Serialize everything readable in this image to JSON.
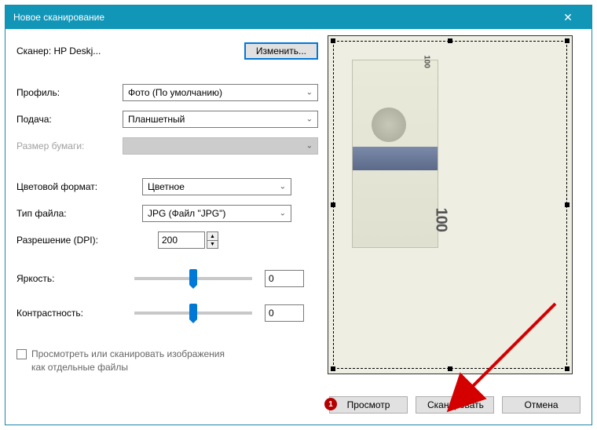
{
  "window": {
    "title": "Новое сканирование",
    "close": "✕"
  },
  "scanner": {
    "label": "Сканер: HP Deskj...",
    "change_button": "Изменить..."
  },
  "profile": {
    "label": "Профиль:",
    "value": "Фото (По умолчанию)"
  },
  "source": {
    "label": "Подача:",
    "value": "Планшетный"
  },
  "paper_size": {
    "label": "Размер бумаги:",
    "value": ""
  },
  "color_format": {
    "label": "Цветовой формат:",
    "value": "Цветное"
  },
  "file_type": {
    "label": "Тип файла:",
    "value": "JPG (Файл \"JPG\")"
  },
  "resolution": {
    "label": "Разрешение (DPI):",
    "value": "200"
  },
  "brightness": {
    "label": "Яркость:",
    "value": "0"
  },
  "contrast": {
    "label": "Контрастность:",
    "value": "0"
  },
  "separate_files": {
    "label": "Просмотреть или сканировать изображения как отдельные файлы"
  },
  "buttons": {
    "preview": "Просмотр",
    "scan": "Сканировать",
    "cancel": "Отмена"
  },
  "annotation": {
    "badge": "1"
  }
}
